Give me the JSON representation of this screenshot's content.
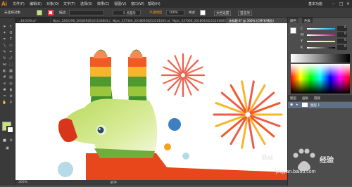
{
  "app": {
    "logo": "Ai",
    "menu": [
      "文件(F)",
      "编辑(E)",
      "对象(O)",
      "文字(T)",
      "选择(S)",
      "效果(C)",
      "视图(V)",
      "窗口(W)",
      "帮助(H)"
    ],
    "workspace": "基本功能",
    "colors": {
      "accent": "#f7941d",
      "chrome_dark": "#2f2f2f",
      "panel": "#4d4d4d"
    }
  },
  "controlbar": {
    "selection_label": "未选择对象",
    "stroke_label": "描边",
    "points_value": "5 点圆形",
    "opacity_label": "不透明度",
    "opacity_value": "100%",
    "style_label": "样式",
    "doc_setup": "文档设置",
    "prefs": "首选项"
  },
  "tabs": [
    "...101639.ai*",
    "Nipic_2262296_20180926101133803.ai*",
    "Nipic_537366_20180928215201005.ai*",
    "Nipic_537366_20180928215201005.ai*",
    "未标题-4* @ 300% (CMYK/预览)"
  ],
  "status": {
    "zoom": "300%",
    "tool": "抓手"
  },
  "color_panel": {
    "tabs": [
      "颜色",
      "色板"
    ],
    "channels": [
      {
        "label": "C",
        "value": "0"
      },
      {
        "label": "M",
        "value": "0"
      },
      {
        "label": "Y",
        "value": "0"
      },
      {
        "label": "K",
        "value": "0"
      }
    ]
  },
  "layers_panel": {
    "tabs": [
      "图层",
      "画板",
      "链接"
    ],
    "layer_name": "图层 1"
  },
  "watermark": {
    "brand": "Bai",
    "brand_suffix": "经验",
    "url": "jingyan.baidu.com"
  }
}
